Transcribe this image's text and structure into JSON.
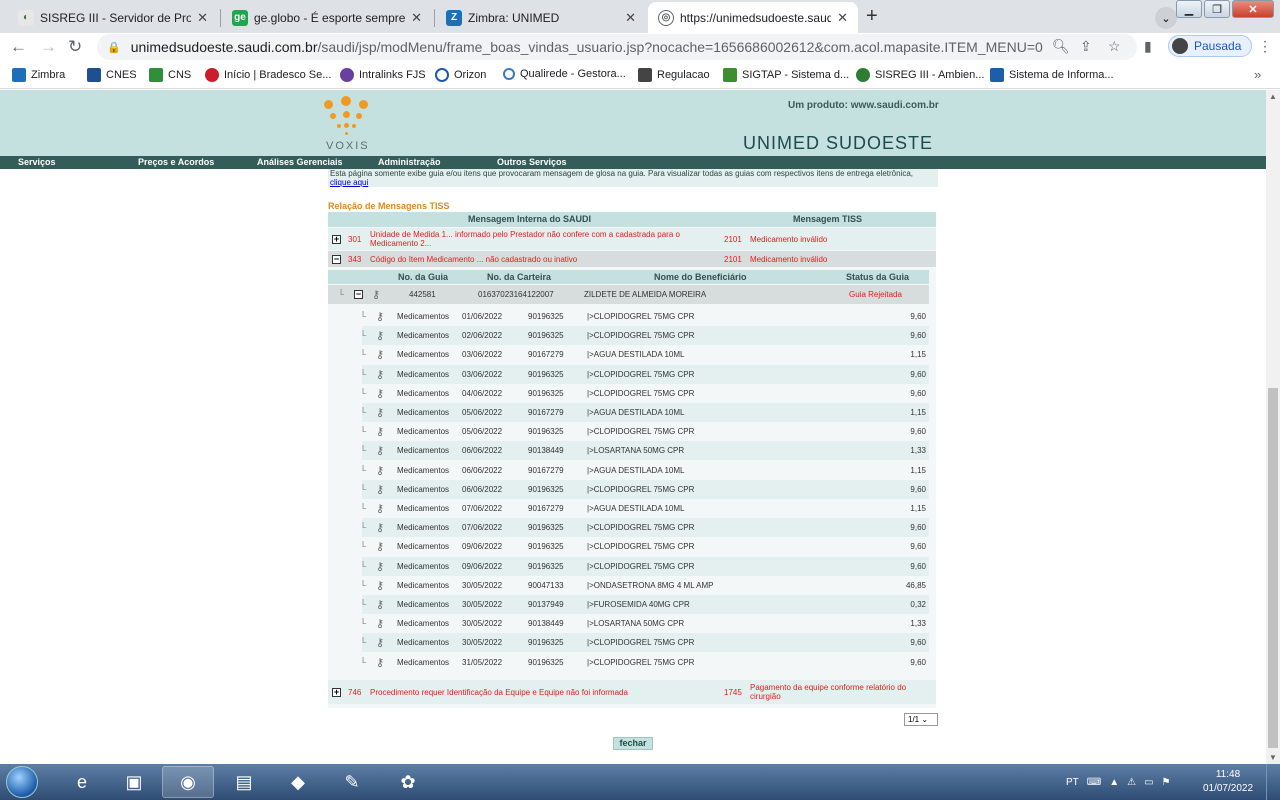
{
  "browser": {
    "tabs": [
      {
        "title": "SISREG III - Servidor de Producac",
        "icon": "sisreg-icon",
        "color": "#2f7d32"
      },
      {
        "title": "ge.globo - É esporte sempre",
        "icon": "ge-icon",
        "color": "#20a64d"
      },
      {
        "title": "Zimbra: UNIMED",
        "icon": "zimbra-icon",
        "color": "#1f6fb8"
      },
      {
        "title": "https://unimedsudoeste.saudi.co",
        "icon": "globe-icon",
        "color": "#5f6368"
      }
    ],
    "url_host": "unimedsudoeste.saudi.com.br",
    "url_path": "/saudi/jsp/modMenu/frame_boas_vindas_usuario.jsp?nocache=1656686002612&com.acol.mapasite.ITEM_MENU=0",
    "profile_label": "Pausada",
    "bookmarks": [
      {
        "label": "Zimbra",
        "color": "#1f6fb8"
      },
      {
        "label": "CNES",
        "color": "#1d4f91"
      },
      {
        "label": "CNS",
        "color": "#2f8f3a"
      },
      {
        "label": "Início | Bradesco Se...",
        "color": "#cc1d2c"
      },
      {
        "label": "Intralinks FJS",
        "color": "#6b3fa0"
      },
      {
        "label": "Orizon",
        "color": "#1a58b5"
      },
      {
        "label": "Qualirede - Gestora...",
        "color": "#3a7bbf"
      },
      {
        "label": "Regulacao",
        "color": "#444444"
      },
      {
        "label": "SIGTAP - Sistema d...",
        "color": "#3e8e2f"
      },
      {
        "label": "SISREG III - Ambien...",
        "color": "#2f7d32"
      },
      {
        "label": "Sistema de Informa...",
        "color": "#1d5ea8"
      }
    ]
  },
  "site": {
    "logo_text": "VOXIS",
    "produto": "Um produto: www.saudi.com.br",
    "brand": "UNIMED SUDOESTE",
    "menu": [
      "Serviços",
      "Preços e Acordos",
      "Análises Gerenciais",
      "Administração",
      "Outros Serviços"
    ]
  },
  "note": {
    "text": "Esta página somente exibe guia e/ou itens que provocaram mensagem de glosa na guia. Para visualizar todas as guias com respectivos itens de entrega eletrônica,",
    "link": "clique aqui"
  },
  "section_title": "Relação de Mensagens TISS",
  "table_headers": {
    "interna": "Mensagem Interna do SAUDI",
    "tiss": "Mensagem TISS"
  },
  "messages": [
    {
      "code": "301",
      "text": "Unidade de Medida 1... informado pelo Prestador não confere com a cadastrada para o Medicamento 2...",
      "tiss_code": "2101",
      "tiss_text": "Medicamento inválido",
      "expanded": false
    },
    {
      "code": "343",
      "text": "Código do Item Medicamento ... não cadastrado ou inativo",
      "tiss_code": "2101",
      "tiss_text": "Medicamento inválido",
      "expanded": true
    },
    {
      "code": "746",
      "text": "Procedimento requer Identificação da Equipe e Equipe não foi informada",
      "tiss_code": "1745",
      "tiss_text": "Pagamento da equipe conforme relatório do cirurgião",
      "expanded": false
    }
  ],
  "guia_headers": {
    "numero": "No. da Guia",
    "carteira": "No. da Carteira",
    "beneficiario": "Nome do Beneficiário",
    "status": "Status da Guia"
  },
  "guia": {
    "numero": "442581",
    "carteira": "01637023164122007",
    "beneficiario": "ZILDETE DE ALMEIDA MOREIRA",
    "status": "Guia Rejeitada"
  },
  "items": [
    {
      "tipo": "Medicamentos",
      "data": "01/06/2022",
      "codigo": "90196325",
      "descricao": "|>CLOPIDOGREL 75MG CPR",
      "valor": "9,60"
    },
    {
      "tipo": "Medicamentos",
      "data": "02/06/2022",
      "codigo": "90196325",
      "descricao": "|>CLOPIDOGREL 75MG CPR",
      "valor": "9,60"
    },
    {
      "tipo": "Medicamentos",
      "data": "03/06/2022",
      "codigo": "90167279",
      "descricao": "|>AGUA DESTILADA 10ML",
      "valor": "1,15"
    },
    {
      "tipo": "Medicamentos",
      "data": "03/06/2022",
      "codigo": "90196325",
      "descricao": "|>CLOPIDOGREL 75MG CPR",
      "valor": "9,60"
    },
    {
      "tipo": "Medicamentos",
      "data": "04/06/2022",
      "codigo": "90196325",
      "descricao": "|>CLOPIDOGREL 75MG CPR",
      "valor": "9,60"
    },
    {
      "tipo": "Medicamentos",
      "data": "05/06/2022",
      "codigo": "90167279",
      "descricao": "|>AGUA DESTILADA 10ML",
      "valor": "1,15"
    },
    {
      "tipo": "Medicamentos",
      "data": "05/06/2022",
      "codigo": "90196325",
      "descricao": "|>CLOPIDOGREL 75MG CPR",
      "valor": "9,60"
    },
    {
      "tipo": "Medicamentos",
      "data": "06/06/2022",
      "codigo": "90138449",
      "descricao": "|>LOSARTANA 50MG CPR",
      "valor": "1,33"
    },
    {
      "tipo": "Medicamentos",
      "data": "06/06/2022",
      "codigo": "90167279",
      "descricao": "|>AGUA DESTILADA 10ML",
      "valor": "1,15"
    },
    {
      "tipo": "Medicamentos",
      "data": "06/06/2022",
      "codigo": "90196325",
      "descricao": "|>CLOPIDOGREL 75MG CPR",
      "valor": "9,60"
    },
    {
      "tipo": "Medicamentos",
      "data": "07/06/2022",
      "codigo": "90167279",
      "descricao": "|>AGUA DESTILADA 10ML",
      "valor": "1,15"
    },
    {
      "tipo": "Medicamentos",
      "data": "07/06/2022",
      "codigo": "90196325",
      "descricao": "|>CLOPIDOGREL 75MG CPR",
      "valor": "9,60"
    },
    {
      "tipo": "Medicamentos",
      "data": "09/06/2022",
      "codigo": "90196325",
      "descricao": "|>CLOPIDOGREL 75MG CPR",
      "valor": "9,60"
    },
    {
      "tipo": "Medicamentos",
      "data": "09/06/2022",
      "codigo": "90196325",
      "descricao": "|>CLOPIDOGREL 75MG CPR",
      "valor": "9,60"
    },
    {
      "tipo": "Medicamentos",
      "data": "30/05/2022",
      "codigo": "90047133",
      "descricao": "|>ONDASETRONA 8MG 4 ML AMP",
      "valor": "46,85"
    },
    {
      "tipo": "Medicamentos",
      "data": "30/05/2022",
      "codigo": "90137949",
      "descricao": "|>FUROSEMIDA 40MG CPR",
      "valor": "0,32"
    },
    {
      "tipo": "Medicamentos",
      "data": "30/05/2022",
      "codigo": "90138449",
      "descricao": "|>LOSARTANA 50MG CPR",
      "valor": "1,33"
    },
    {
      "tipo": "Medicamentos",
      "data": "30/05/2022",
      "codigo": "90196325",
      "descricao": "|>CLOPIDOGREL 75MG CPR",
      "valor": "9,60"
    },
    {
      "tipo": "Medicamentos",
      "data": "31/05/2022",
      "codigo": "90196325",
      "descricao": "|>CLOPIDOGREL 75MG CPR",
      "valor": "9,60"
    }
  ],
  "pagination": "1/1",
  "close_label": "fechar",
  "taskbar": {
    "apps": [
      "ie-icon",
      "media-player-icon",
      "chrome-icon",
      "explorer-icon",
      "notes-icon",
      "syringe-app-icon",
      "paint-icon"
    ],
    "lang": "PT",
    "time": "11:48",
    "date": "01/07/2022"
  }
}
